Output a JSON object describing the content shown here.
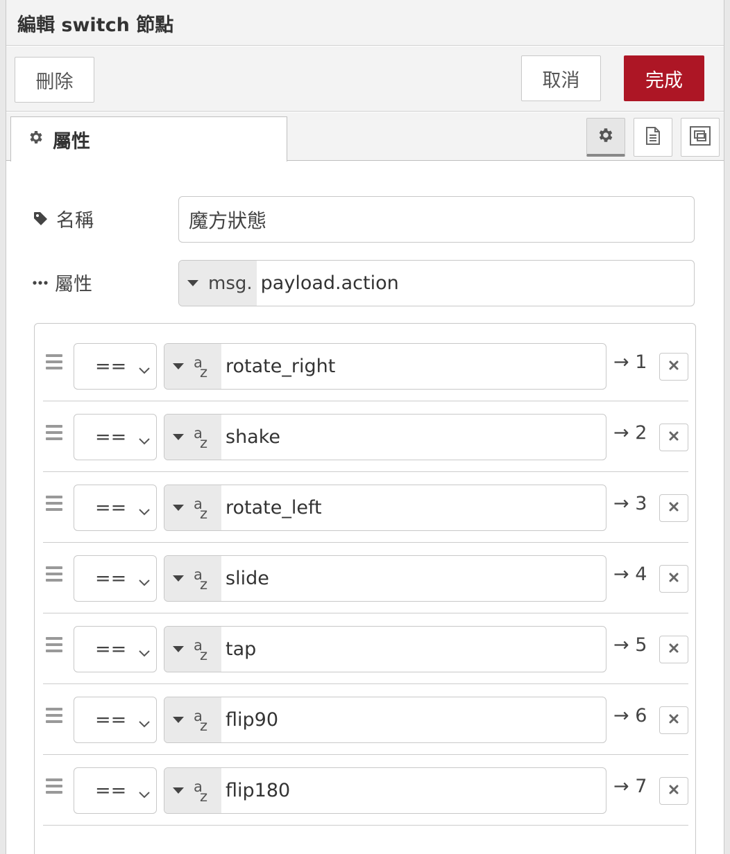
{
  "tray": {
    "title": "編輯 switch 節點"
  },
  "toolbar": {
    "delete_label": "刪除",
    "cancel_label": "取消",
    "done_label": "完成",
    "done_color": "#ad1625"
  },
  "tabs": {
    "active_label": "屬性",
    "active_icon": "gear-icon",
    "icon_buttons": [
      "gear-icon",
      "document-icon",
      "frame-icon"
    ]
  },
  "form": {
    "name_label": "名稱",
    "name_icon": "tag-icon",
    "name_value": "魔方狀態",
    "property_label": "屬性",
    "property_icon": "ellipsis-icon",
    "property_type": "msg.",
    "property_value": "payload.action"
  },
  "rules": [
    {
      "operator": "==",
      "value": "rotate_right",
      "output": "→ 1"
    },
    {
      "operator": "==",
      "value": "shake",
      "output": "→ 2"
    },
    {
      "operator": "==",
      "value": "rotate_left",
      "output": "→ 3"
    },
    {
      "operator": "==",
      "value": "slide",
      "output": "→ 4"
    },
    {
      "operator": "==",
      "value": "tap",
      "output": "→ 5"
    },
    {
      "operator": "==",
      "value": "flip90",
      "output": "→ 6"
    },
    {
      "operator": "==",
      "value": "flip180",
      "output": "→ 7"
    }
  ],
  "value_type_icon": {
    "a": "a",
    "z": "z"
  }
}
